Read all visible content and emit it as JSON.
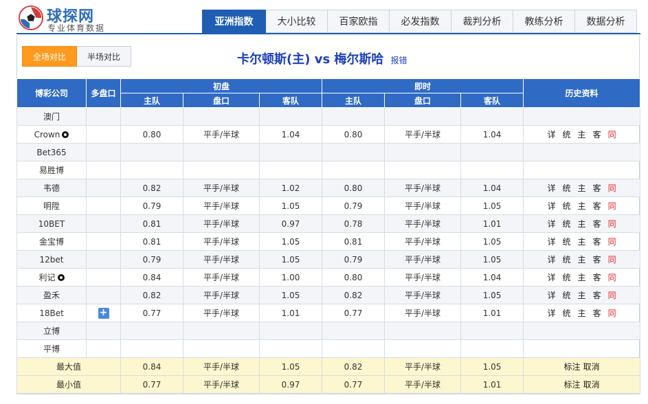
{
  "brand": {
    "name": "球探网",
    "tagline": "专业体育数据"
  },
  "nav": {
    "tabs": [
      "亚洲指数",
      "大小比较",
      "百家欧指",
      "必发指数",
      "裁判分析",
      "教练分析",
      "数据分析"
    ]
  },
  "toggle": {
    "full": "全场对比",
    "half": "半场对比"
  },
  "match": {
    "title": "卡尔顿斯(主) vs 梅尔斯哈",
    "report": "报错"
  },
  "table": {
    "headers": {
      "company": "博彩公司",
      "multi": "多盘口",
      "initial": "初盘",
      "live": "即时",
      "history": "历史资料",
      "home": "主队",
      "line": "盘口",
      "away": "客队"
    },
    "rows": [
      {
        "company": "澳门",
        "ball": false,
        "plus": false
      },
      {
        "company": "Crown",
        "ball": true,
        "plus": false,
        "ih": "0.80",
        "il": "平手/半球",
        "ia": "1.04",
        "lh": "0.80",
        "ll": "平手/半球",
        "la": "1.04"
      },
      {
        "company": "Bet365",
        "ball": false,
        "plus": false
      },
      {
        "company": "易胜博",
        "ball": false,
        "plus": false
      },
      {
        "company": "韦德",
        "ball": false,
        "plus": false,
        "ih": "0.82",
        "il": "平手/半球",
        "ia": "1.02",
        "lh": "0.80",
        "ll": "平手/半球",
        "la": "1.04"
      },
      {
        "company": "明陞",
        "ball": false,
        "plus": false,
        "ih": "0.79",
        "il": "平手/半球",
        "ia": "1.05",
        "lh": "0.79",
        "ll": "平手/半球",
        "la": "1.05"
      },
      {
        "company": "10BET",
        "ball": false,
        "plus": false,
        "ih": "0.81",
        "il": "平手/半球",
        "ia": "0.97",
        "lh": "0.78",
        "ll": "平手/半球",
        "la": "1.01"
      },
      {
        "company": "金宝博",
        "ball": false,
        "plus": false,
        "ih": "0.81",
        "il": "平手/半球",
        "ia": "1.05",
        "lh": "0.81",
        "ll": "平手/半球",
        "la": "1.05"
      },
      {
        "company": "12bet",
        "ball": false,
        "plus": false,
        "ih": "0.79",
        "il": "平手/半球",
        "ia": "1.05",
        "lh": "0.79",
        "ll": "平手/半球",
        "la": "1.05"
      },
      {
        "company": "利记",
        "ball": true,
        "plus": false,
        "ih": "0.84",
        "il": "平手/半球",
        "ia": "1.00",
        "lh": "0.80",
        "ll": "平手/半球",
        "la": "1.04"
      },
      {
        "company": "盈禾",
        "ball": false,
        "plus": false,
        "ih": "0.82",
        "il": "平手/半球",
        "ia": "1.05",
        "lh": "0.82",
        "ll": "平手/半球",
        "la": "1.05"
      },
      {
        "company": "18Bet",
        "ball": false,
        "plus": true,
        "ih": "0.77",
        "il": "平手/半球",
        "ia": "1.01",
        "lh": "0.77",
        "ll": "平手/半球",
        "la": "1.01"
      },
      {
        "company": "立博",
        "ball": false,
        "plus": false
      },
      {
        "company": "平博",
        "ball": false,
        "plus": false
      }
    ],
    "history_links": [
      "详",
      "统",
      "主",
      "客",
      "同"
    ],
    "plus_symbol": "+",
    "footer": [
      {
        "label": "最大值",
        "ih": "0.84",
        "il": "平手/半球",
        "ia": "1.05",
        "lh": "0.82",
        "ll": "平手/半球",
        "la": "1.05"
      },
      {
        "label": "最小值",
        "ih": "0.77",
        "il": "平手/半球",
        "ia": "0.97",
        "lh": "0.77",
        "ll": "平手/半球",
        "la": "1.01"
      }
    ],
    "footer_links": [
      "标注",
      "取消"
    ]
  },
  "colors": {
    "accent": "#1f5eb3",
    "header_bg": "#2f6bc5",
    "toggle_on": "#ff9a1f",
    "footer_bg": "#fdf7cf",
    "link_red": "#e02020"
  }
}
